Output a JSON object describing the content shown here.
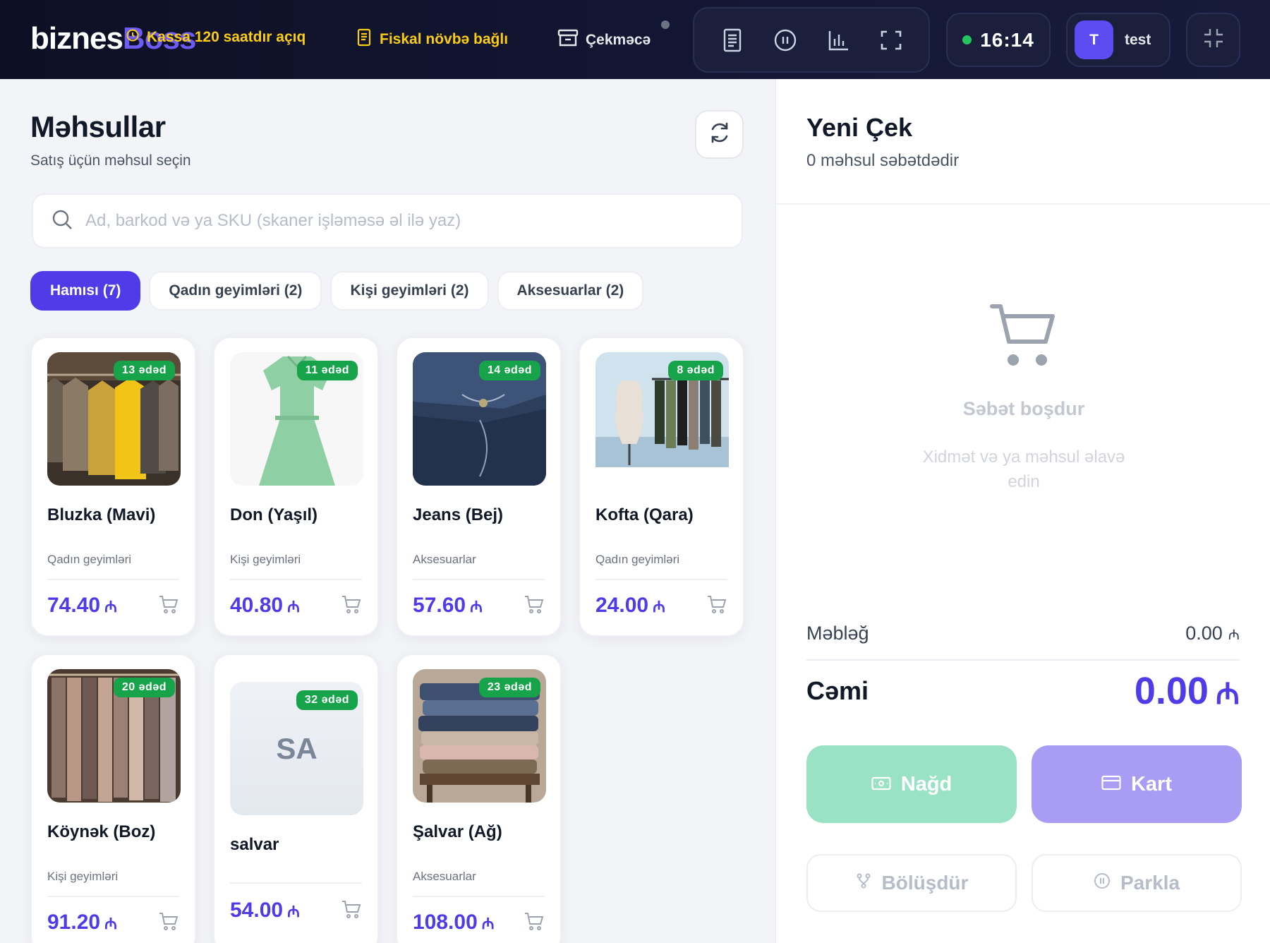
{
  "header": {
    "logo_part1": "biznes",
    "logo_part2": "Boss",
    "kassa_status": "Kassa 120 saatdır açıq",
    "fiscal_status": "Fiskal növbə bağlı",
    "drawer_label": "Çekməcə",
    "toolbar_icons": [
      "receipt-icon",
      "pause-icon",
      "chart-icon",
      "fullscreen-icon"
    ],
    "clock": "16:14",
    "user": {
      "initial": "T",
      "name": "test"
    }
  },
  "products": {
    "title": "Məhsullar",
    "subtitle": "Satış üçün məhsul seçin",
    "search_placeholder": "Ad, barkod və ya SKU (skaner işləməsə əl ilə yaz)",
    "tabs": [
      {
        "label": "Hamısı (7)",
        "active": true
      },
      {
        "label": "Qadın geyimləri (2)",
        "active": false
      },
      {
        "label": "Kişi geyimləri (2)",
        "active": false
      },
      {
        "label": "Aksesuarlar (2)",
        "active": false
      }
    ],
    "items": [
      {
        "name": "Bluzka (Mavi)",
        "stock": "13 ədəd",
        "category": "Qadın geyimləri",
        "price": "74.40",
        "currency": "₼",
        "image": "clothes-rack"
      },
      {
        "name": "Don (Yaşıl)",
        "stock": "11 ədəd",
        "category": "Kişi geyimləri",
        "price": "40.80",
        "currency": "₼",
        "image": "green-dress"
      },
      {
        "name": "Jeans (Bej)",
        "stock": "14 ədəd",
        "category": "Aksesuarlar",
        "price": "57.60",
        "currency": "₼",
        "image": "denim-jeans"
      },
      {
        "name": "Kofta (Qara)",
        "stock": "8 ədəd",
        "category": "Qadın geyimləri",
        "price": "24.00",
        "currency": "₼",
        "image": "boutique-rack"
      },
      {
        "name": "Köynək (Boz)",
        "stock": "20 ədəd",
        "category": "Kişi geyimləri",
        "price": "91.20",
        "currency": "₼",
        "image": "shirts-rack"
      },
      {
        "name": "salvar",
        "stock": "32 ədəd",
        "category": "",
        "price": "54.00",
        "currency": "₼",
        "image": "none",
        "initials": "SA"
      },
      {
        "name": "Şalvar (Ağ)",
        "stock": "23 ədəd",
        "category": "Aksesuarlar",
        "price": "108.00",
        "currency": "₼",
        "image": "folded-jeans"
      }
    ]
  },
  "cart": {
    "title": "Yeni Çek",
    "subtitle": "0 məhsul səbətdədir",
    "empty_title": "Səbət boşdur",
    "empty_desc": "Xidmət və ya məhsul əlavə edin",
    "amount_label": "Məbləğ",
    "amount_value": "0.00",
    "total_label": "Cəmi",
    "total_value": "0.00",
    "currency": "₼",
    "cash_label": "Nağd",
    "card_label": "Kart",
    "split_label": "Bölüşdür",
    "park_label": "Parkla"
  },
  "colors": {
    "accent": "#4f3be8",
    "header_bg": "#0d1024",
    "stock_badge": "#16a34a",
    "status_warning": "#facc15",
    "cash_button": "#99e2c6",
    "card_button": "#a99cf4"
  }
}
